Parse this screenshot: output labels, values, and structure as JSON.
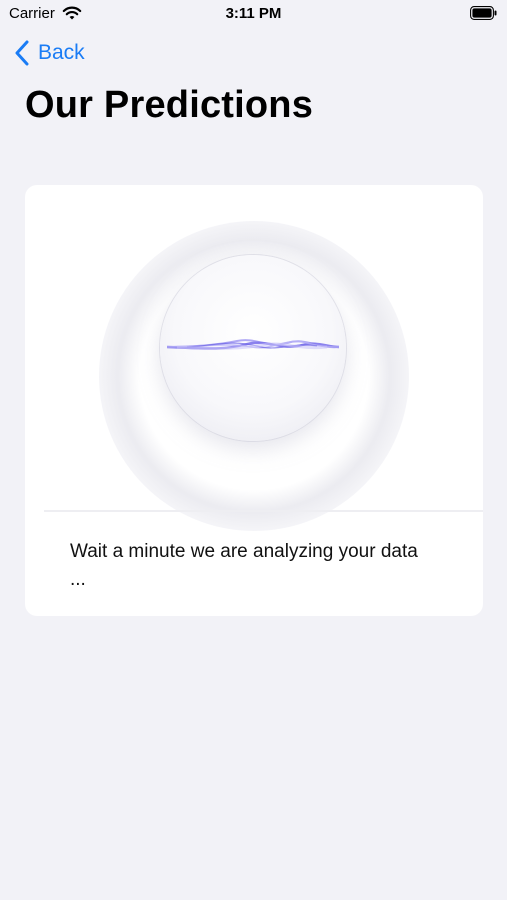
{
  "status_bar": {
    "carrier": "Carrier",
    "time": "3:11 PM",
    "wifi_icon": "wifi-icon",
    "battery_icon": "battery-icon"
  },
  "nav": {
    "back_label": "Back",
    "back_icon": "chevron-left-icon"
  },
  "page": {
    "title": "Our Predictions"
  },
  "card": {
    "message": "Wait a minute we are analyzing your data ...",
    "animation": "siri-wave-orb"
  },
  "colors": {
    "background": "#f2f2f7",
    "accent": "#1a7cf5",
    "card": "#ffffff",
    "wave": "#8b83f0"
  }
}
